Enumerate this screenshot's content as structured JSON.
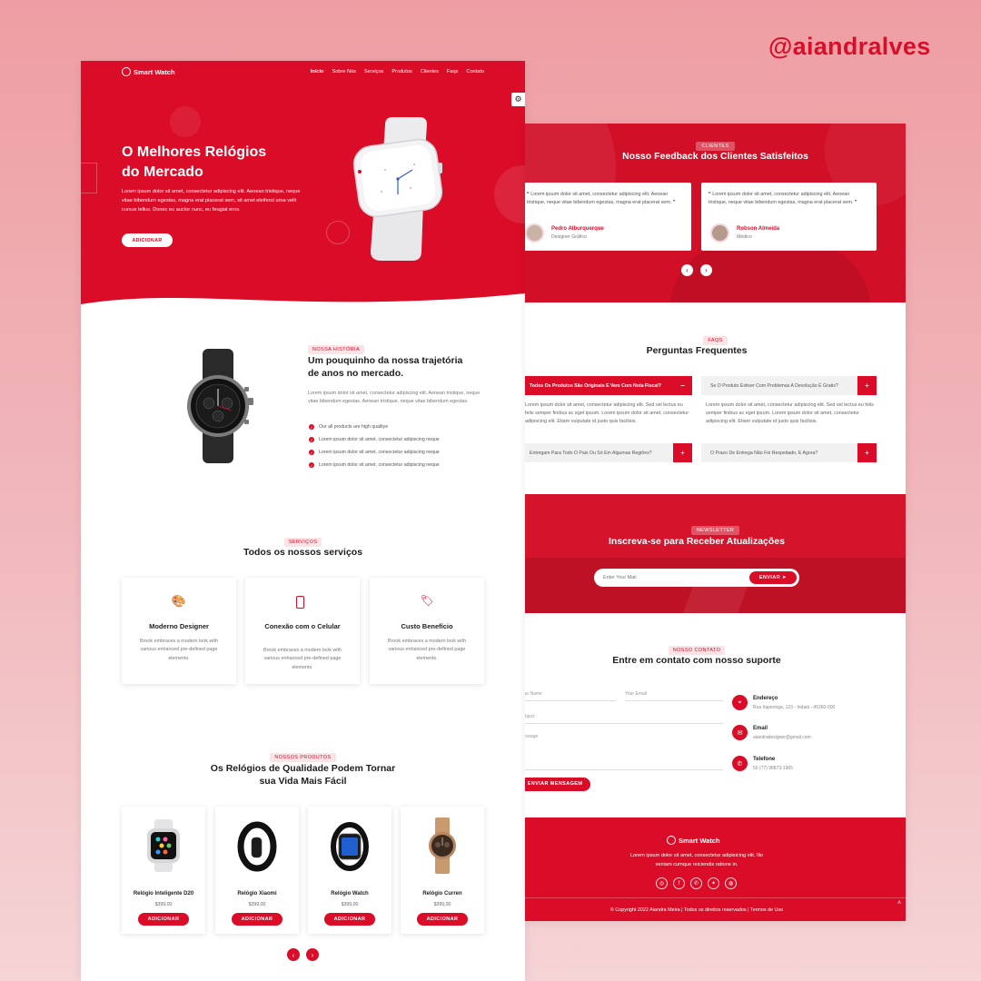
{
  "handle": "@aiandralves",
  "header": {
    "brand": "Smart Watch",
    "nav": [
      "Início",
      "Sobre Nós",
      "Serviços",
      "Produtos",
      "Clientes",
      "Faqs",
      "Contato"
    ]
  },
  "hero": {
    "title_line1": "O Melhores Relógios",
    "title_line2": "do Mercado",
    "text": "Lorem ipsum dolor sit amet, consectetur adipiscing elit. Aenean tristique, neque vitae bibendum egestas, magna erat placerat sem, sit amet eleifend urna velit cursus tellus. Donec eu auctor nunc, eu feugiat eros.",
    "button": "ADICIONAR"
  },
  "about": {
    "tag": "NOSSA HISTÓRIA",
    "title_line1": "Um pouquinho da nossa trajetória",
    "title_line2": "de anos no mercado.",
    "text": "Lorem ipsum dolor sit amet, consectetur adipiscing elit. Aenean tristique, neque vitae bibendum egestas. Aenean tristique, neque vitae bibendum egestas.",
    "features": [
      "Our all products are high qualitye",
      "Lorem ipsum dolor sit amet, consectetur adipiscing neque",
      "Lorem ipsum dolor sit amet, consectetur adipiscing neque",
      "Lorem ipsum dolor sit amet, consectetur adipiscing neque"
    ]
  },
  "services": {
    "tag": "SERVIÇOS",
    "title": "Todos os nossos serviços",
    "items": [
      {
        "title": "Moderno Designer",
        "desc": "Brook embraces a modern look with various enhanced pre-defined page elements."
      },
      {
        "title": "Conexão com o Celular",
        "desc": "Brook embraces a modern look with various enhanced pre-defined page elements."
      },
      {
        "title": "Custo Benefício",
        "desc": "Brook embraces a modern look with various enhanced pre-defined page elements."
      }
    ]
  },
  "products": {
    "tag": "NOSSOS PRODUTOS",
    "title_line1": "Os Relógios de Qualidade Podem Tornar",
    "title_line2": "sua Vida Mais Fácil",
    "button": "ADICIONAR",
    "items": [
      {
        "name": "Relógio Inteligente D20",
        "price": "$399,00"
      },
      {
        "name": "Relógio Xiaomi",
        "price": "$399,00"
      },
      {
        "name": "Relógio Watch",
        "price": "$399,00"
      },
      {
        "name": "Relógio Curren",
        "price": "$399,00"
      }
    ]
  },
  "clients": {
    "tag": "CLIENTES",
    "title": "Nosso Feedback dos Clientes Satisfeitos",
    "items": [
      {
        "text": "Lorem ipsum dolor sit amet, consectetur adipiscing elit. Aenean tristique, neque vitae bibendum egestas, magna erat placerat sem.",
        "name": "Pedro Alburquerque",
        "role": "Designer Gráfico"
      },
      {
        "text": "Lorem ipsum dolor sit amet, consectetur adipiscing elit. Aenean tristique, neque vitae bibendum egestas, magna erat placerat sem.",
        "name": "Robson Almeida",
        "role": "Médico"
      }
    ]
  },
  "faqs": {
    "tag": "FAQS",
    "title": "Perguntas Frequentes",
    "q1": "Todos Os Produtos São Originais E Vem Com Nota Fiscal?",
    "q2": "Se O Produto Estiver Com Problemas A Devolução É Gratis?",
    "a": "Lorem ipsum dolor sit amet, consectetur adipiscing elit. Sed vel lectus eu felis semper finibus ac eget ipsum. Lorem ipsum dolor sit amet, consectetur adipiscing elit. Etiam vulputate id justo quis facilisis.",
    "q3": "Entregam Para Todo O Pais Ou Só Em Algumas Regiões?",
    "q4": "O Prazo De Entrega Não Foi Respeitado, E Agora?"
  },
  "newsletter": {
    "tag": "NEWSLETTER",
    "title": "Inscreva-se para Receber Atualizações",
    "placeholder": "Enter Your Mail",
    "button": "ENVIAR"
  },
  "contact": {
    "tag": "NOSSO CONTATO",
    "title": "Entre em contato com nosso suporte",
    "f_name": "Your Name",
    "f_email": "Your Email",
    "f_subject": "Subject",
    "f_message": "Message",
    "button": "ENVIAR MENSAGEM",
    "address_t": "Endereço",
    "address_v": "Rua Itaperinga, 123 - Indaiá - 45260-000",
    "email_t": "Email",
    "email_v": "aiandradesigner@gmail.com",
    "phone_t": "Telefone",
    "phone_v": "55 (77) 98873-1965"
  },
  "footer": {
    "brand": "Smart Watch",
    "text_line1": "Lorem ipsum dolor sit amet, consectetur adipisicing elit. Illo",
    "text_line2": "veniam cumque reiciendis ratione in.",
    "copyright": "© Copyright 2022 Aiandra Meira | Todos os direitos reservados | Termos de Uso"
  }
}
